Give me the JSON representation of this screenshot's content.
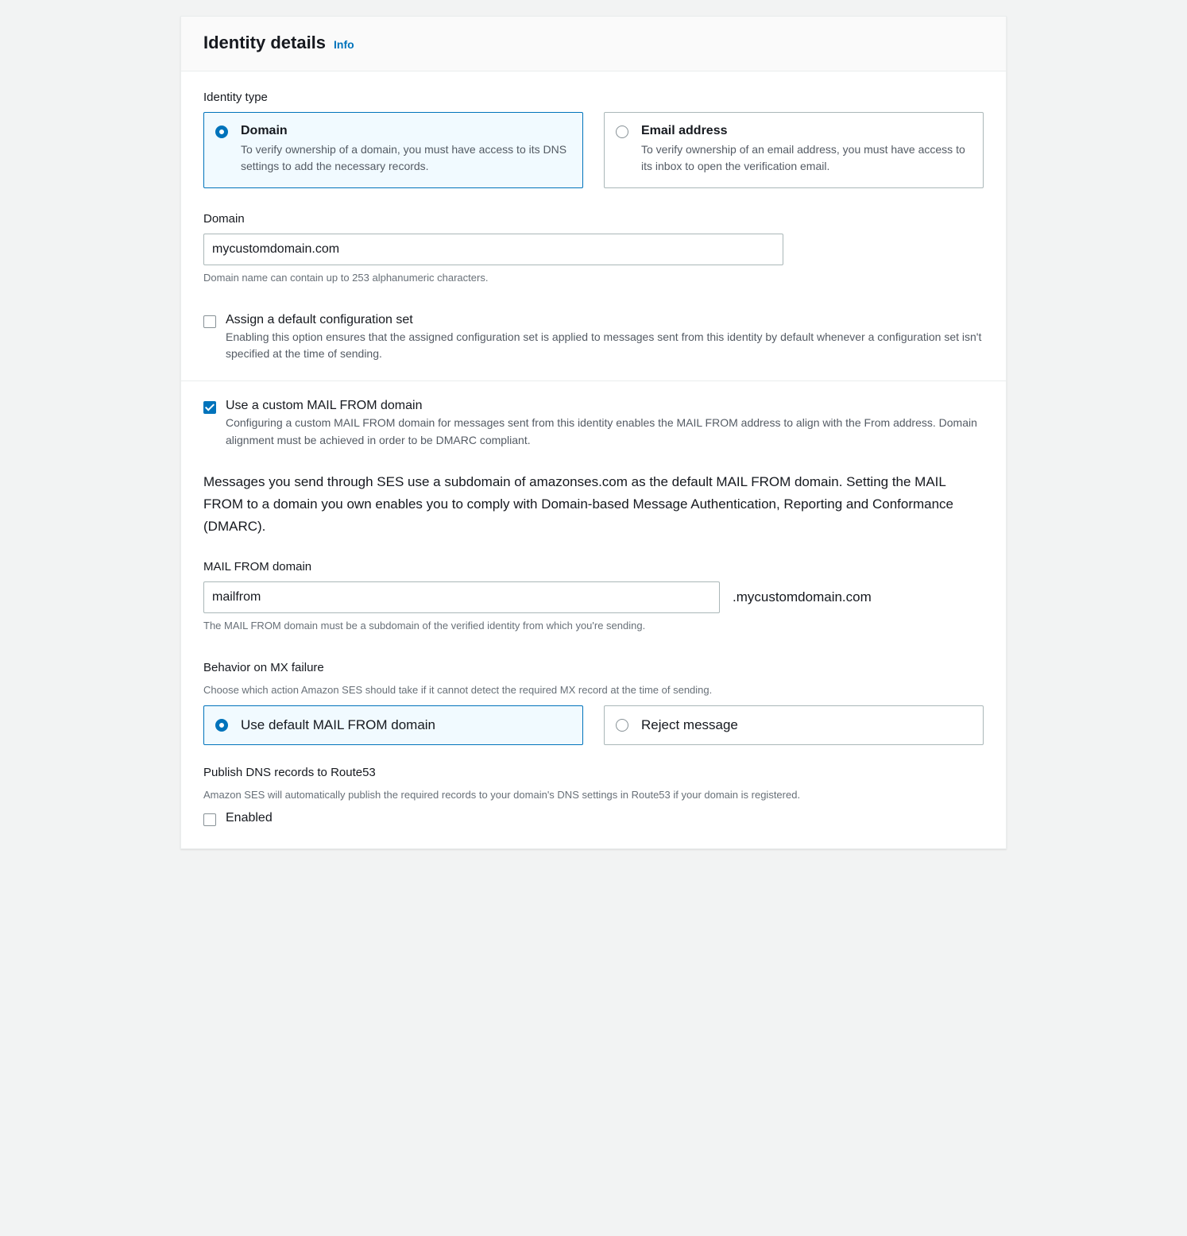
{
  "header": {
    "title": "Identity details",
    "info": "Info"
  },
  "identity_type": {
    "label": "Identity type",
    "options": [
      {
        "title": "Domain",
        "desc": "To verify ownership of a domain, you must have access to its DNS settings to add the necessary records."
      },
      {
        "title": "Email address",
        "desc": "To verify ownership of an email address, you must have access to its inbox to open the verification email."
      }
    ]
  },
  "domain": {
    "label": "Domain",
    "value": "mycustomdomain.com",
    "hint": "Domain name can contain up to 253 alphanumeric characters."
  },
  "config_set": {
    "label": "Assign a default configuration set",
    "desc": "Enabling this option ensures that the assigned configuration set is applied to messages sent from this identity by default whenever a configuration set isn't specified at the time of sending."
  },
  "mail_from": {
    "label": "Use a custom MAIL FROM domain",
    "desc": "Configuring a custom MAIL FROM domain for messages sent from this identity enables the MAIL FROM address to align with the From address. Domain alignment must be achieved in order to be DMARC compliant."
  },
  "paragraph": "Messages you send through SES use a subdomain of amazonses.com as the default MAIL FROM domain. Setting the MAIL FROM to a domain you own enables you to comply with Domain-based Message Authentication, Reporting and Conformance (DMARC).",
  "mail_from_domain": {
    "label": "MAIL FROM domain",
    "value": "mailfrom",
    "suffix": ".mycustomdomain.com",
    "hint": "The MAIL FROM domain must be a subdomain of the verified identity from which you're sending."
  },
  "mx_failure": {
    "label": "Behavior on MX failure",
    "hint": "Choose which action Amazon SES should take if it cannot detect the required MX record at the time of sending.",
    "options": [
      {
        "title": "Use default MAIL FROM domain"
      },
      {
        "title": "Reject message"
      }
    ]
  },
  "route53": {
    "label": "Publish DNS records to Route53",
    "hint": "Amazon SES will automatically publish the required records to your domain's DNS settings in Route53 if your domain is registered.",
    "checkbox_label": "Enabled"
  }
}
